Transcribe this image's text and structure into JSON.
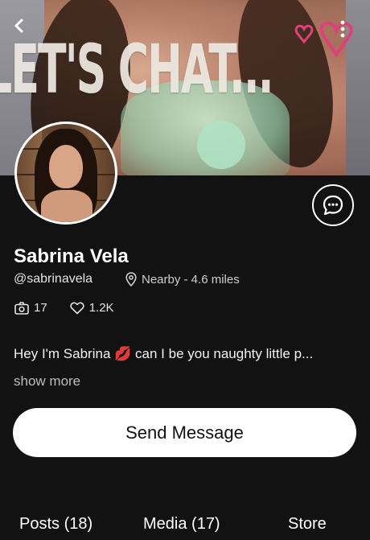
{
  "banner": {
    "text": "LET'S CHAT...",
    "back_icon": "chevron-left-icon",
    "more_icon": "more-vertical-icon",
    "decor_color": "#e0407a"
  },
  "profile": {
    "name": "Sabrina Vela",
    "handle": "@sabrinavela",
    "location": "Nearby - 4.6 miles",
    "location_icon": "map-pin-icon",
    "media_count": "17",
    "likes": "1.2K",
    "bio_text": "Hey I'm Sabrina",
    "bio_emoji": "💋",
    "bio_rest": "can I be you naughty little p...",
    "show_more": "show more"
  },
  "actions": {
    "chat_icon": "chat-bubble-icon",
    "send_message": "Send Message"
  },
  "tabs": [
    {
      "label": "Posts (18)"
    },
    {
      "label": "Media (17)"
    },
    {
      "label": "Store"
    }
  ]
}
